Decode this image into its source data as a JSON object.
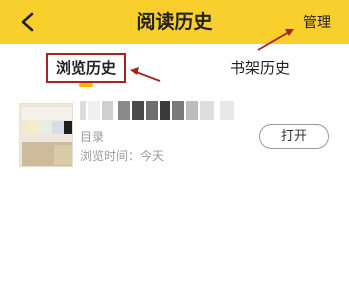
{
  "header": {
    "title": "阅读历史",
    "back_icon": "chevron-left-icon",
    "manage_label": "管理"
  },
  "tabs": [
    {
      "label": "浏览历史",
      "active": true
    },
    {
      "label": "书架历史",
      "active": false
    }
  ],
  "history": [
    {
      "chapter": "目录",
      "browse_time": "浏览时间：今天",
      "open_label": "打开"
    }
  ],
  "colors": {
    "topbar": "#f9cf2d",
    "annotation": "#a52422",
    "tab_indicator": "#f5b400"
  }
}
